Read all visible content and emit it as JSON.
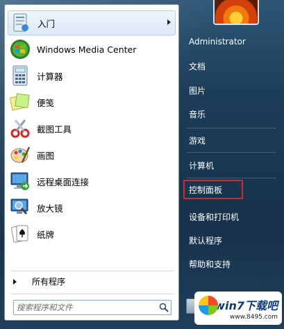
{
  "pinned": [
    {
      "label": "入门",
      "icon": "getting-started-icon",
      "has_submenu": true
    },
    {
      "label": "Windows Media Center",
      "icon": "windows-media-center-icon"
    },
    {
      "label": "计算器",
      "icon": "calculator-icon"
    },
    {
      "label": "便笺",
      "icon": "sticky-notes-icon"
    },
    {
      "label": "截图工具",
      "icon": "snipping-tool-icon"
    },
    {
      "label": "画图",
      "icon": "paint-icon"
    },
    {
      "label": "远程桌面连接",
      "icon": "remote-desktop-icon"
    },
    {
      "label": "放大镜",
      "icon": "magnifier-icon"
    },
    {
      "label": "纸牌",
      "icon": "solitaire-icon"
    }
  ],
  "all_programs_label": "所有程序",
  "search": {
    "placeholder": "搜索程序和文件"
  },
  "right_items": [
    {
      "label": "Administrator"
    },
    {
      "label": "文档"
    },
    {
      "label": "图片"
    },
    {
      "label": "音乐"
    },
    {
      "label": "游戏"
    },
    {
      "label": "计算机"
    },
    {
      "label": "控制面板",
      "highlighted": true
    },
    {
      "label": "设备和打印机"
    },
    {
      "label": "默认程序"
    },
    {
      "label": "帮助和支持"
    }
  ],
  "watermark": {
    "brand": "win7下载吧",
    "url": "www.8495.com"
  },
  "colors": {
    "highlight_border": "#d8262a",
    "panel_bg": "#1c3d58"
  }
}
